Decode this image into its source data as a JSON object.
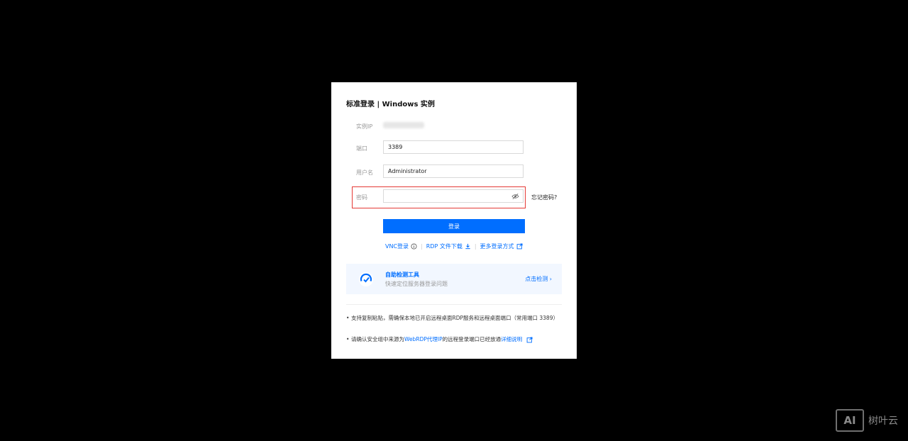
{
  "dialog": {
    "title": "标准登录 | Windows 实例",
    "instance_ip_label": "实例IP",
    "port_label": "端口",
    "port_value": "3389",
    "username_label": "用户名",
    "username_value": "Administrator",
    "password_label": "密码",
    "password_value": "",
    "forgot_password": "忘记密码?",
    "login_button": "登录",
    "links": {
      "vnc": "VNC登录",
      "rdp": "RDP 文件下载",
      "more": "更多登录方式"
    },
    "tool": {
      "name": "自助检测工具",
      "desc": "快速定位服务器登录问题",
      "check": "点击检测 ›"
    },
    "notes": {
      "note1": "支持复制粘贴，需确保本地已开启远程桌面RDP服务和远程桌面端口（常用端口 3389）",
      "note2_prefix": "请确认安全组中来源为",
      "note2_link": "WebRDP代理IP",
      "note2_middle": "的远程登录端口已经放通",
      "note2_detail": "详细说明"
    }
  },
  "watermark": {
    "logo": "AI",
    "text": "树叶云"
  },
  "colors": {
    "accent": "#006eff",
    "highlight": "#e53935",
    "background": "#000000"
  },
  "icons": [
    "eye-off-icon",
    "info-icon",
    "download-icon",
    "external-link-icon",
    "gauge-icon"
  ]
}
